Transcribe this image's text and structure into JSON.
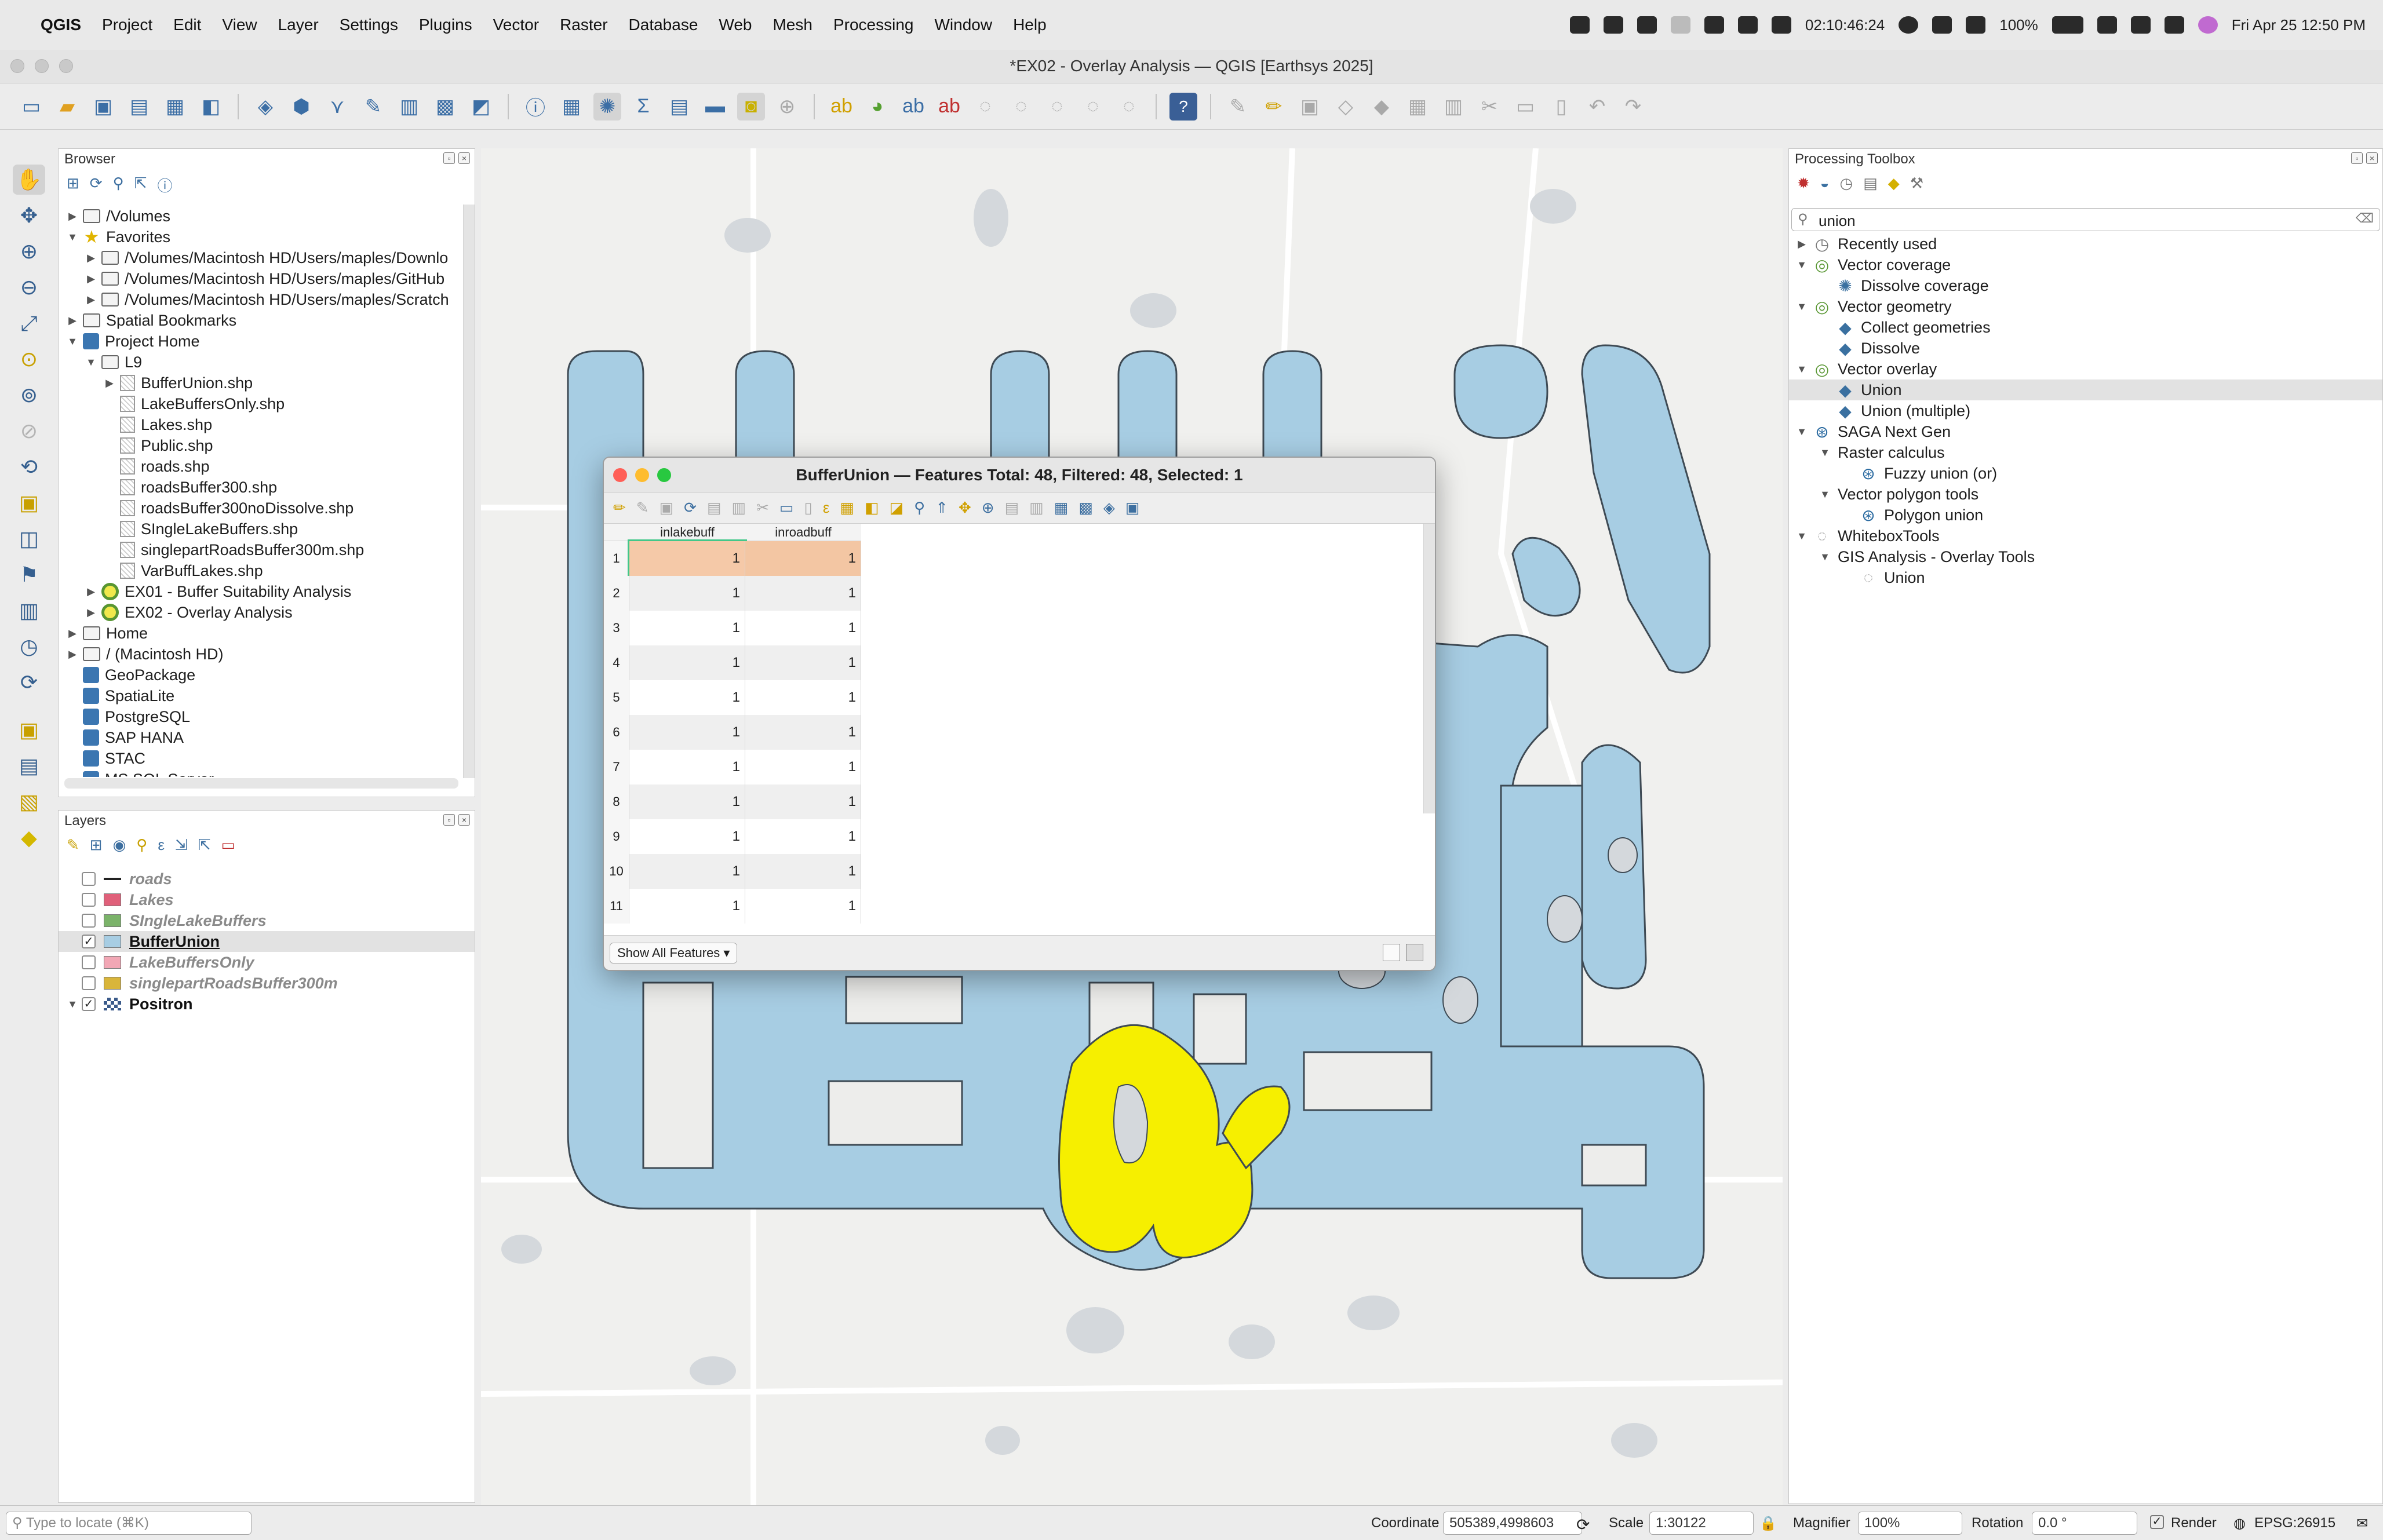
{
  "menubar": {
    "app": "QGIS",
    "items": [
      "Project",
      "Edit",
      "View",
      "Layer",
      "Settings",
      "Plugins",
      "Vector",
      "Raster",
      "Database",
      "Web",
      "Mesh",
      "Processing",
      "Window",
      "Help"
    ],
    "timer": "02:10:46:24",
    "battery": "100%",
    "datetime": "Fri Apr 25  12:50 PM"
  },
  "window": {
    "title": "*EX02 - Overlay Analysis — QGIS [Earthsys 2025]"
  },
  "browser": {
    "title": "Browser",
    "items": [
      {
        "label": "/Volumes",
        "level": 0,
        "arrow": "▶",
        "icon": "fold"
      },
      {
        "label": "Favorites",
        "level": 0,
        "arrow": "▼",
        "icon": "star"
      },
      {
        "label": "/Volumes/Macintosh HD/Users/maples/Downlo",
        "level": 1,
        "arrow": "▶",
        "icon": "fold"
      },
      {
        "label": "/Volumes/Macintosh HD/Users/maples/GitHub",
        "level": 1,
        "arrow": "▶",
        "icon": "fold"
      },
      {
        "label": "/Volumes/Macintosh HD/Users/maples/Scratch",
        "level": 1,
        "arrow": "▶",
        "icon": "fold"
      },
      {
        "label": "Spatial Bookmarks",
        "level": 0,
        "arrow": "▶",
        "icon": "fold"
      },
      {
        "label": "Project Home",
        "level": 0,
        "arrow": "▼",
        "icon": "gen"
      },
      {
        "label": "L9",
        "level": 1,
        "arrow": "▼",
        "icon": "fold"
      },
      {
        "label": "BufferUnion.shp",
        "level": 2,
        "arrow": "▶",
        "icon": "shp"
      },
      {
        "label": "LakeBuffersOnly.shp",
        "level": 2,
        "arrow": "",
        "icon": "shp"
      },
      {
        "label": "Lakes.shp",
        "level": 2,
        "arrow": "",
        "icon": "shp"
      },
      {
        "label": "Public.shp",
        "level": 2,
        "arrow": "",
        "icon": "shp"
      },
      {
        "label": "roads.shp",
        "level": 2,
        "arrow": "",
        "icon": "shp"
      },
      {
        "label": "roadsBuffer300.shp",
        "level": 2,
        "arrow": "",
        "icon": "shp"
      },
      {
        "label": "roadsBuffer300noDissolve.shp",
        "level": 2,
        "arrow": "",
        "icon": "shp"
      },
      {
        "label": "SIngleLakeBuffers.shp",
        "level": 2,
        "arrow": "",
        "icon": "shp"
      },
      {
        "label": "singlepartRoadsBuffer300m.shp",
        "level": 2,
        "arrow": "",
        "icon": "shp"
      },
      {
        "label": "VarBuffLakes.shp",
        "level": 2,
        "arrow": "",
        "icon": "shp"
      },
      {
        "label": "EX01 - Buffer Suitability Analysis",
        "level": 1,
        "arrow": "▶",
        "icon": "qg"
      },
      {
        "label": "EX02 - Overlay Analysis",
        "level": 1,
        "arrow": "▶",
        "icon": "qg"
      },
      {
        "label": "Home",
        "level": 0,
        "arrow": "▶",
        "icon": "fold"
      },
      {
        "label": "/ (Macintosh HD)",
        "level": 0,
        "arrow": "▶",
        "icon": "fold"
      },
      {
        "label": "GeoPackage",
        "level": 0,
        "arrow": "",
        "icon": "gen"
      },
      {
        "label": "SpatiaLite",
        "level": 0,
        "arrow": "",
        "icon": "gen"
      },
      {
        "label": "PostgreSQL",
        "level": 0,
        "arrow": "",
        "icon": "gen"
      },
      {
        "label": "SAP HANA",
        "level": 0,
        "arrow": "",
        "icon": "gen"
      },
      {
        "label": "STAC",
        "level": 0,
        "arrow": "",
        "icon": "gen"
      },
      {
        "label": "MS SQL Server",
        "level": 0,
        "arrow": "",
        "icon": "gen"
      }
    ]
  },
  "layers": {
    "title": "Layers",
    "items": [
      {
        "label": "roads",
        "checked": false,
        "color": "#222222",
        "kind": "line",
        "style": "off"
      },
      {
        "label": "Lakes",
        "checked": false,
        "color": "#e0607a",
        "kind": "fill",
        "style": "off"
      },
      {
        "label": "SIngleLakeBuffers",
        "checked": false,
        "color": "#7bb36a",
        "kind": "fill",
        "style": "off"
      },
      {
        "label": "BufferUnion",
        "checked": true,
        "color": "#a7cde3",
        "kind": "fill",
        "style": "on"
      },
      {
        "label": "LakeBuffersOnly",
        "checked": false,
        "color": "#f2a7b5",
        "kind": "fill",
        "style": "off"
      },
      {
        "label": "singlepartRoadsBuffer300m",
        "checked": false,
        "color": "#d9b53a",
        "kind": "fill",
        "style": "off"
      },
      {
        "label": "Positron",
        "checked": true,
        "color": "#3a5a8a",
        "kind": "group",
        "style": "bold"
      }
    ]
  },
  "attribute_table": {
    "title": "BufferUnion — Features Total: 48, Filtered: 48, Selected: 1",
    "columns": [
      "inlakebuff",
      "inroadbuff"
    ],
    "rows": [
      [
        "1",
        "1",
        "1"
      ],
      [
        "2",
        "1",
        "1"
      ],
      [
        "3",
        "1",
        "1"
      ],
      [
        "4",
        "1",
        "1"
      ],
      [
        "5",
        "1",
        "1"
      ],
      [
        "6",
        "1",
        "1"
      ],
      [
        "7",
        "1",
        "1"
      ],
      [
        "8",
        "1",
        "1"
      ],
      [
        "9",
        "1",
        "1"
      ],
      [
        "10",
        "1",
        "1"
      ],
      [
        "11",
        "1",
        "1"
      ]
    ],
    "show_all": "Show All Features"
  },
  "processing": {
    "title": "Processing Toolbox",
    "search": "union",
    "items": [
      {
        "label": "Recently used",
        "level": 0,
        "arrow": "▶",
        "icon": "clock"
      },
      {
        "label": "Vector coverage",
        "level": 0,
        "arrow": "▼",
        "icon": "q"
      },
      {
        "label": "Dissolve coverage",
        "level": 1,
        "arrow": "",
        "icon": "gear"
      },
      {
        "label": "Vector geometry",
        "level": 0,
        "arrow": "▼",
        "icon": "q"
      },
      {
        "label": "Collect geometries",
        "level": 1,
        "arrow": "",
        "icon": "alg"
      },
      {
        "label": "Dissolve",
        "level": 1,
        "arrow": "",
        "icon": "alg"
      },
      {
        "label": "Vector overlay",
        "level": 0,
        "arrow": "▼",
        "icon": "q"
      },
      {
        "label": "Union",
        "level": 1,
        "arrow": "",
        "icon": "alg",
        "selected": true
      },
      {
        "label": "Union (multiple)",
        "level": 1,
        "arrow": "",
        "icon": "alg"
      },
      {
        "label": "SAGA Next Gen",
        "level": 0,
        "arrow": "▼",
        "icon": "saga"
      },
      {
        "label": "Raster calculus",
        "level": 1,
        "arrow": "▼",
        "icon": ""
      },
      {
        "label": "Fuzzy union (or)",
        "level": 2,
        "arrow": "",
        "icon": "saga"
      },
      {
        "label": "Vector polygon tools",
        "level": 1,
        "arrow": "▼",
        "icon": ""
      },
      {
        "label": "Polygon union",
        "level": 2,
        "arrow": "",
        "icon": "saga"
      },
      {
        "label": "WhiteboxTools",
        "level": 0,
        "arrow": "▼",
        "icon": "wb"
      },
      {
        "label": "GIS Analysis - Overlay Tools",
        "level": 1,
        "arrow": "▼",
        "icon": ""
      },
      {
        "label": "Union",
        "level": 2,
        "arrow": "",
        "icon": "wb"
      }
    ]
  },
  "statusbar": {
    "locate_placeholder": "Type to locate (⌘K)",
    "coordinate_label": "Coordinate",
    "coordinate": "505389,4998603",
    "scale_label": "Scale",
    "scale": "1:30122",
    "magnifier_label": "Magnifier",
    "magnifier": "100%",
    "rotation_label": "Rotation",
    "rotation": "0.0 °",
    "render_label": "Render",
    "crs": "EPSG:26915"
  },
  "colors": {
    "buffer_fill": "#a7cde3",
    "selected_fill": "#f6ef00",
    "map_bg": "#f0f0ee",
    "water": "#d4d8dc"
  }
}
